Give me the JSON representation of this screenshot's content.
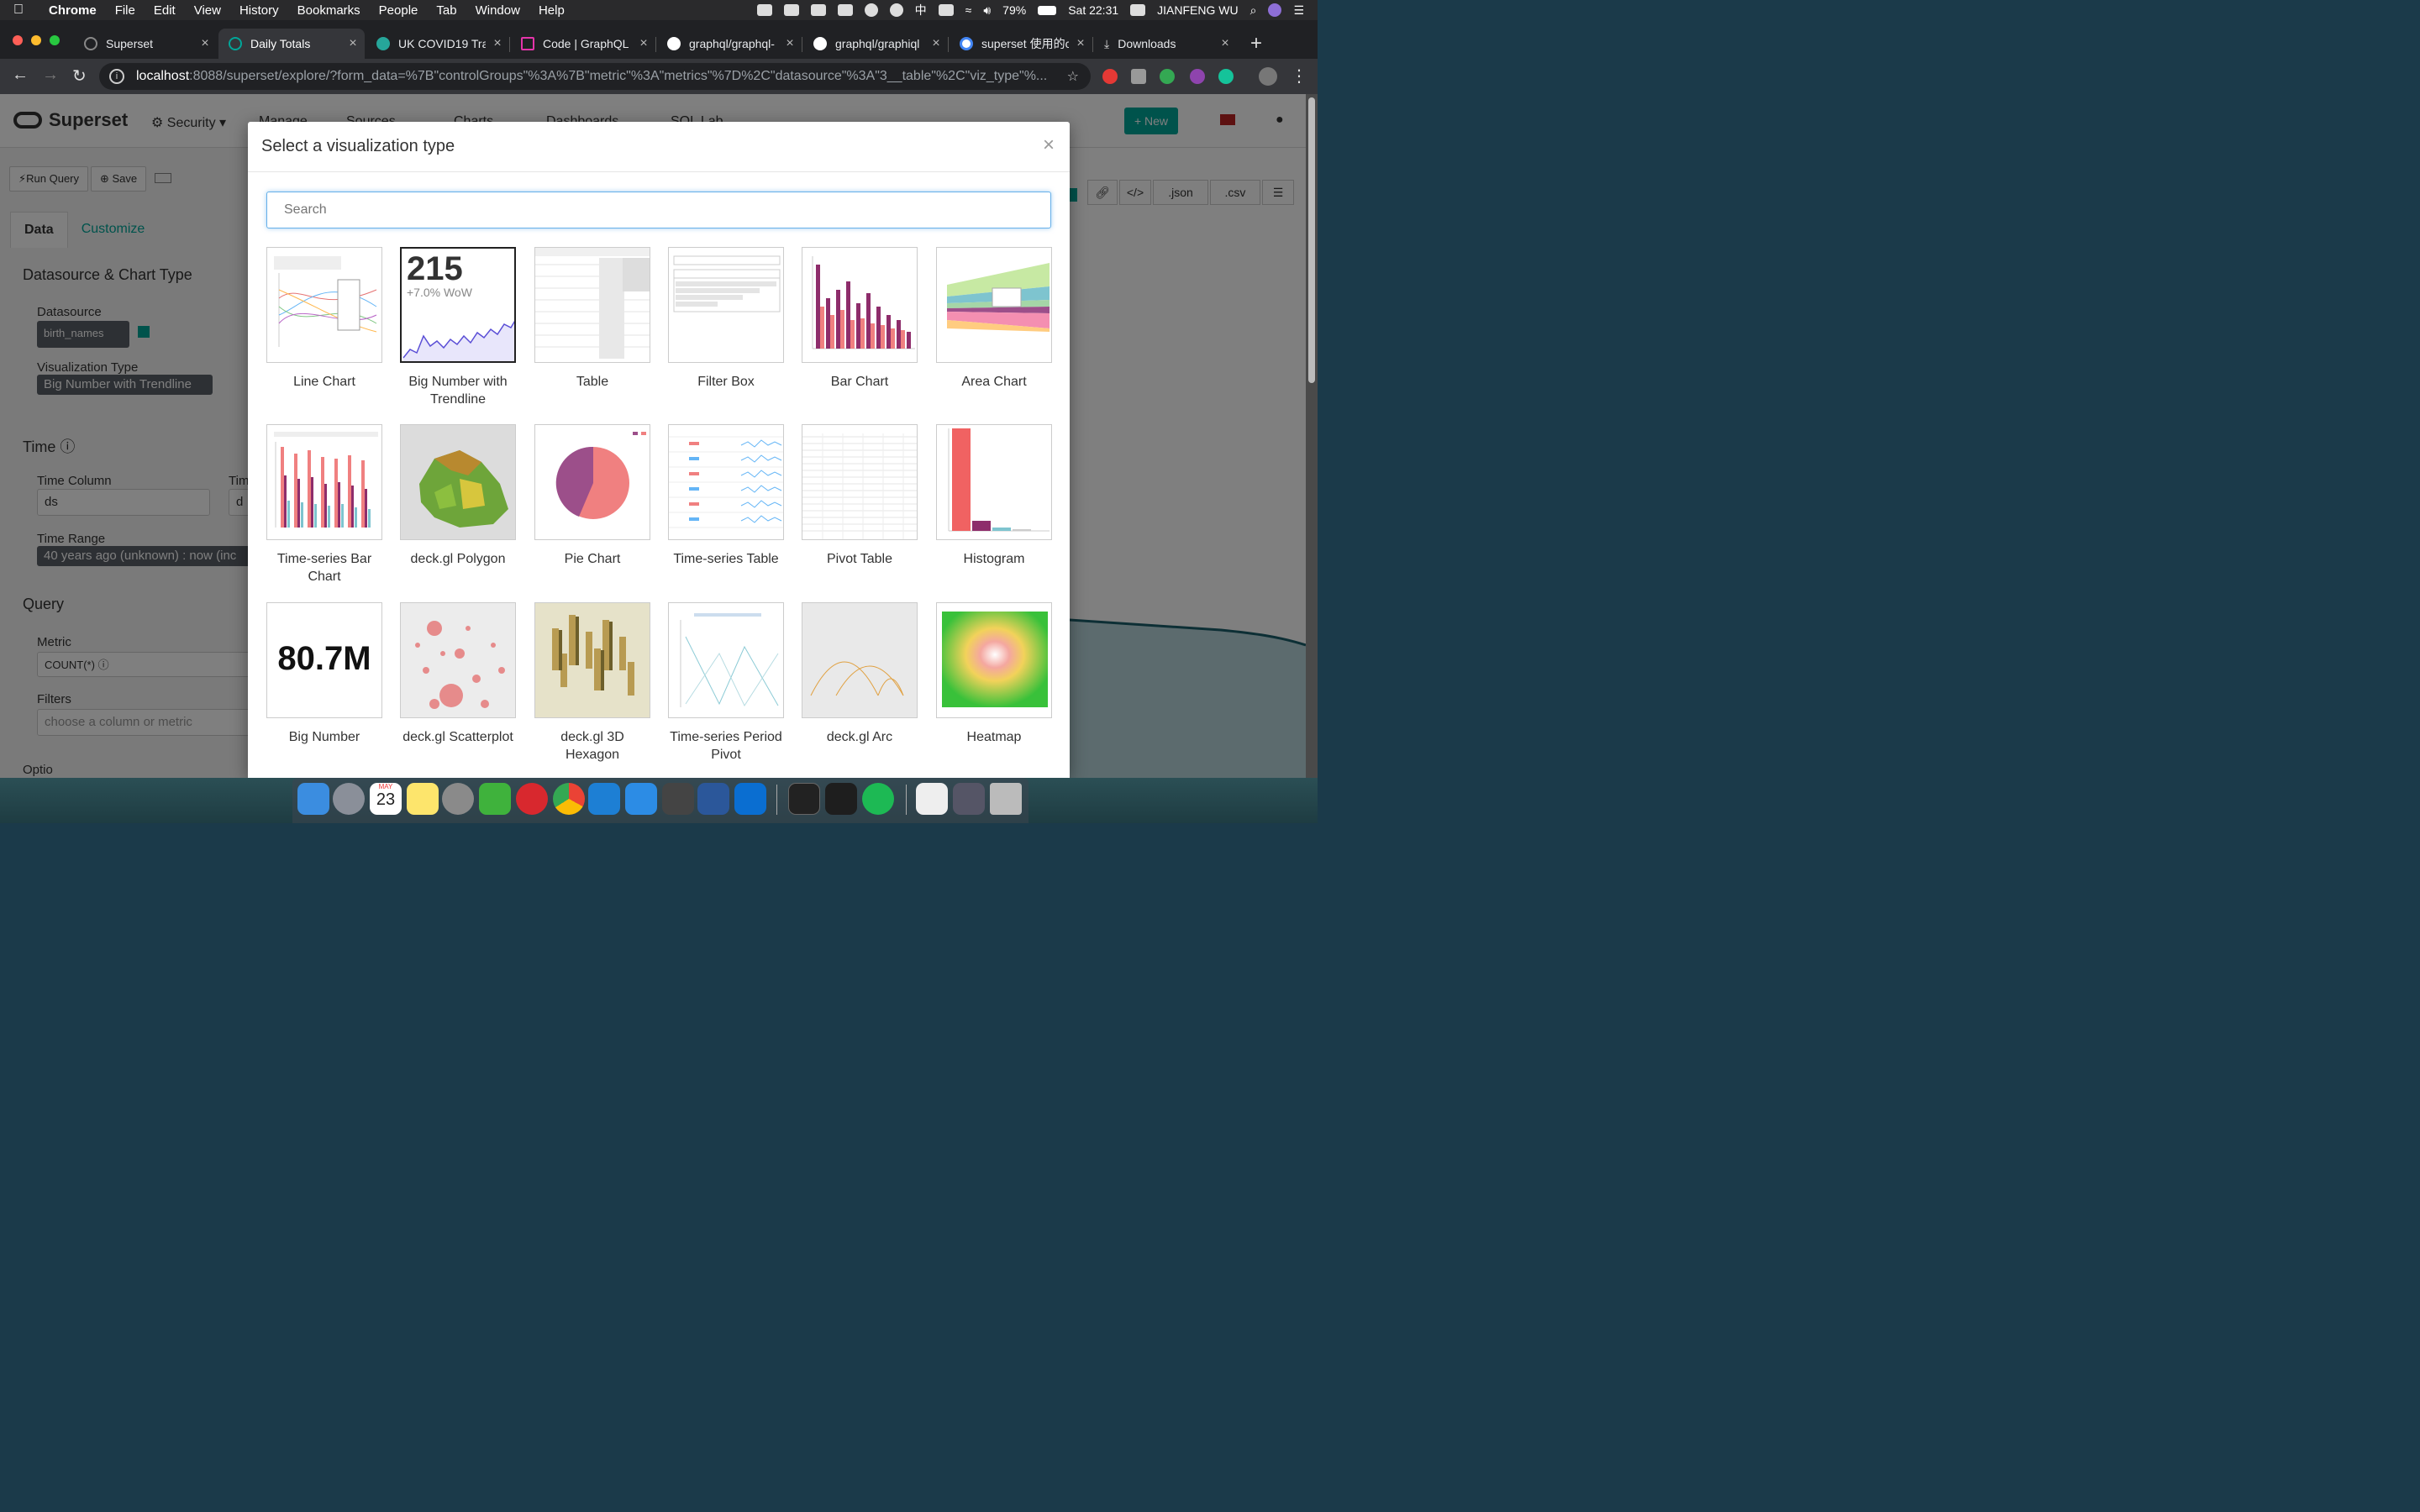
{
  "menubar": {
    "items": [
      "Chrome",
      "File",
      "Edit",
      "View",
      "History",
      "Bookmarks",
      "People",
      "Tab",
      "Window",
      "Help"
    ],
    "battery": "79%",
    "clock": "Sat 22:31",
    "user": "JIANFENG WU",
    "ime": "中"
  },
  "tabs": [
    {
      "title": "Superset",
      "color": "#555"
    },
    {
      "title": "Daily Totals",
      "color": "#00a699"
    },
    {
      "title": "UK COVID19 Trac",
      "color": "#26a69a"
    },
    {
      "title": "Code | GraphQL",
      "color": "#e535ab"
    },
    {
      "title": "graphql/graphql-",
      "color": "#fff"
    },
    {
      "title": "graphql/graphiql",
      "color": "#fff"
    },
    {
      "title": "superset 使用的c",
      "color": "#4285f4"
    },
    {
      "title": "Downloads",
      "color": "#ddd"
    }
  ],
  "address": {
    "host": "localhost",
    "path": ":8088/superset/explore/?form_data=%7B\"controlGroups\"%3A%7B\"metric\"%3A\"metrics\"%7D%2C\"datasource\"%3A\"3__table\"%2C\"viz_type\"%..."
  },
  "navbar": {
    "brand": "Superset",
    "links": [
      "Security",
      "Manage",
      "Sources",
      "Charts",
      "Dashboards",
      "SQL Lab"
    ],
    "new_label": "+ New"
  },
  "left": {
    "run_query": "Run Query",
    "save": "Save",
    "tab_data": "Data",
    "tab_customize": "Customize",
    "section_ds": "Datasource & Chart Type",
    "datasource_label": "Datasource",
    "datasource_value": "birth_names",
    "viz_label": "Visualization Type",
    "viz_value": "Big Number with Trendline",
    "section_time": "Time",
    "time_column_label": "Time Column",
    "time_column_value": "ds",
    "time_grain_label": "Tim",
    "time_grain_value": "d",
    "time_range_label": "Time Range",
    "time_range_value": "40 years ago (unknown) : now (inc",
    "section_query": "Query",
    "metric_label": "Metric",
    "metric_value": "COUNT(*)",
    "filters_label": "Filters",
    "filters_placeholder": "choose a column or metric",
    "cut_label": "Optio"
  },
  "right_tools": [
    ".json",
    ".csv"
  ],
  "modal": {
    "title": "Select a visualization type",
    "close": "×",
    "search_placeholder": "Search",
    "cards": [
      {
        "name": "Line Chart"
      },
      {
        "name": "Big Number with Trendline",
        "big": "215",
        "sub": "+7.0% WoW"
      },
      {
        "name": "Table"
      },
      {
        "name": "Filter Box"
      },
      {
        "name": "Bar Chart"
      },
      {
        "name": "Area Chart"
      },
      {
        "name": "Time-series Bar Chart"
      },
      {
        "name": "deck.gl Polygon"
      },
      {
        "name": "Pie Chart"
      },
      {
        "name": "Time-series Table"
      },
      {
        "name": "Pivot Table"
      },
      {
        "name": "Histogram"
      },
      {
        "name": "Big Number",
        "big": "80.7M"
      },
      {
        "name": "deck.gl Scatterplot"
      },
      {
        "name": "deck.gl 3D Hexagon"
      },
      {
        "name": "Time-series Period Pivot"
      },
      {
        "name": "deck.gl Arc"
      },
      {
        "name": "Heatmap"
      }
    ]
  },
  "dock": {
    "calendar_month": "MAY",
    "calendar_day": "23",
    "apps": [
      "finder-icon",
      "launchpad-icon",
      "calendar-icon",
      "notes-icon",
      "system-preferences-icon",
      "wechat-icon",
      "netease-music-icon",
      "chrome-icon",
      "vscode-icon",
      "xcode-icon",
      "code-icon",
      "word-icon",
      "outlook-icon",
      "terminal-icon",
      "figma-icon",
      "spotify-icon",
      "document-icon",
      "screenshot-icon",
      "trash-icon"
    ]
  }
}
